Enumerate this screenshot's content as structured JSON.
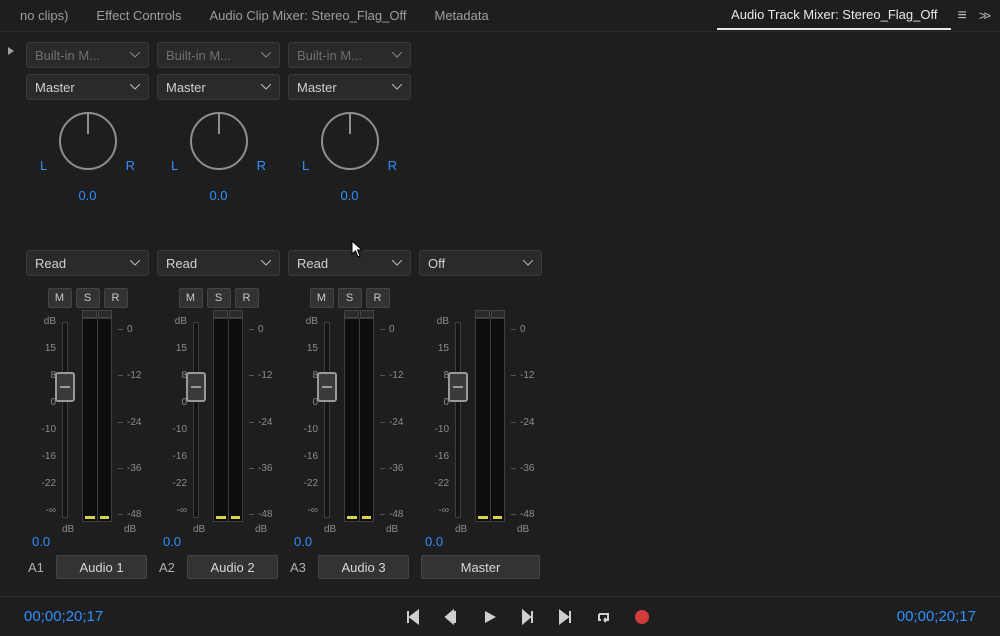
{
  "tabs": {
    "t0": "no clips)",
    "t1": "Effect Controls",
    "t2": "Audio Clip Mixer: Stereo_Flag_Off",
    "t3": "Metadata",
    "t4": "Audio Track Mixer: Stereo_Flag_Off"
  },
  "dropdown": {
    "effect_label": "Built-in M...",
    "output_label": "Master",
    "automation_read": "Read",
    "automation_off": "Off"
  },
  "pan": {
    "L": "L",
    "R": "R",
    "value": "0.0"
  },
  "msr": {
    "m": "M",
    "s": "S",
    "r": "R"
  },
  "scale_left": {
    "v0": "dB",
    "v1": "15",
    "v2": "8",
    "v3": "0",
    "v4": "-10",
    "v5": "-16",
    "v6": "-22",
    "v7": "-∞"
  },
  "scale_right": {
    "v0": "0",
    "v1": "-12",
    "v2": "-24",
    "v3": "-36",
    "v4": "-48"
  },
  "db_label": "dB",
  "fader_value": "0.0",
  "tracks": {
    "a1": {
      "id": "A1",
      "name": "Audio 1"
    },
    "a2": {
      "id": "A2",
      "name": "Audio 2"
    },
    "a3": {
      "id": "A3",
      "name": "Audio 3"
    },
    "master": {
      "name": "Master"
    }
  },
  "timecode": {
    "left": "00;00;20;17",
    "right": "00;00;20;17"
  }
}
